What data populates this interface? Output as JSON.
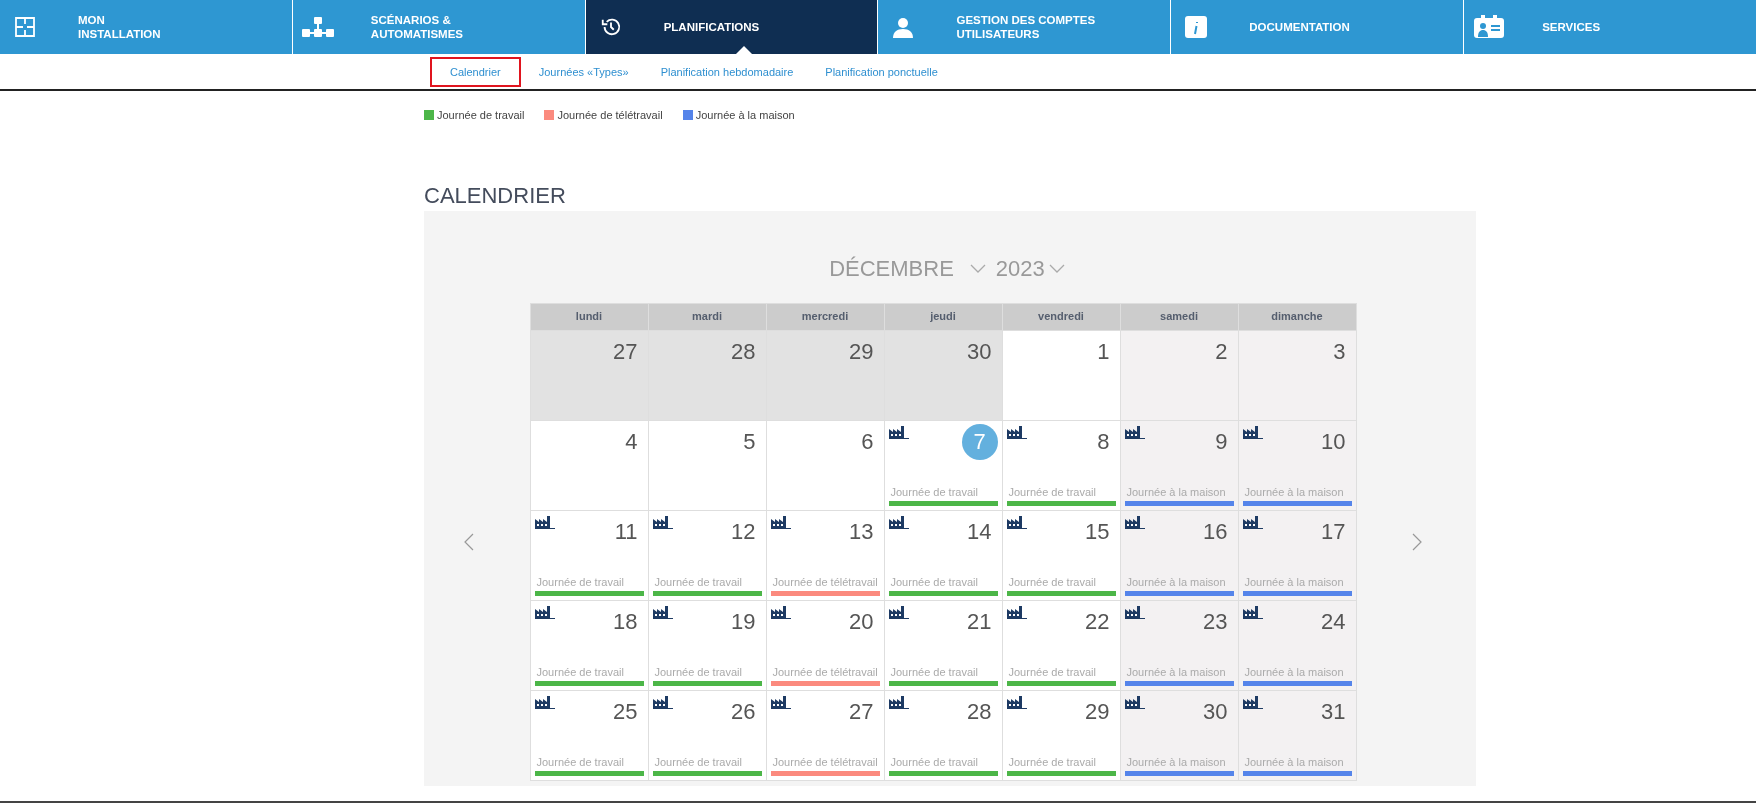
{
  "nav": [
    {
      "label": "MON\nINSTALLATION",
      "kind": "plan",
      "selected": false
    },
    {
      "label": "SCÉNARIOS &\nAUTOMATISMES",
      "kind": "flow",
      "selected": false
    },
    {
      "label": "PLANIFICATIONS",
      "kind": "history",
      "selected": true
    },
    {
      "label": "GESTION DES COMPTES\nUTILISATEURS",
      "kind": "user",
      "selected": false
    },
    {
      "label": "DOCUMENTATION",
      "kind": "info",
      "selected": false
    },
    {
      "label": "SERVICES",
      "kind": "badge",
      "selected": false
    }
  ],
  "subnav": [
    {
      "label": "Calendrier",
      "selected": true
    },
    {
      "label": "Journées «Types»",
      "selected": false
    },
    {
      "label": "Planification hebdomadaire",
      "selected": false
    },
    {
      "label": "Planification ponctuelle",
      "selected": false
    }
  ],
  "legend": [
    {
      "label": "Journée de travail",
      "color": "#4cb648"
    },
    {
      "label": "Journée de télétravail",
      "color": "#fb8a7e"
    },
    {
      "label": "Journée à la maison",
      "color": "#5584ea"
    }
  ],
  "title": "CALENDRIER",
  "calendar": {
    "month": "DÉCEMBRE",
    "year": "2023",
    "weekdays": [
      "lundi",
      "mardi",
      "mercredi",
      "jeudi",
      "vendredi",
      "samedi",
      "dimanche"
    ],
    "weeks": [
      [
        {
          "day": "27",
          "kind": "outside"
        },
        {
          "day": "28",
          "kind": "outside"
        },
        {
          "day": "29",
          "kind": "outside"
        },
        {
          "day": "30",
          "kind": "outside"
        },
        {
          "day": "1",
          "kind": "weekday"
        },
        {
          "day": "2",
          "kind": "weekend"
        },
        {
          "day": "3",
          "kind": "weekend"
        }
      ],
      [
        {
          "day": "4",
          "kind": "weekday"
        },
        {
          "day": "5",
          "kind": "weekday"
        },
        {
          "day": "6",
          "kind": "weekday"
        },
        {
          "day": "7",
          "kind": "weekday",
          "today": true,
          "scheduled": true,
          "label": "Journée de travail",
          "color": "#4cb648"
        },
        {
          "day": "8",
          "kind": "weekday",
          "scheduled": true,
          "label": "Journée de travail",
          "color": "#4cb648"
        },
        {
          "day": "9",
          "kind": "weekend",
          "scheduled": true,
          "label": "Journée à la maison",
          "color": "#5584ea"
        },
        {
          "day": "10",
          "kind": "weekend",
          "scheduled": true,
          "label": "Journée à la maison",
          "color": "#5584ea"
        }
      ],
      [
        {
          "day": "11",
          "kind": "weekday",
          "scheduled": true,
          "label": "Journée de travail",
          "color": "#4cb648"
        },
        {
          "day": "12",
          "kind": "weekday",
          "scheduled": true,
          "label": "Journée de travail",
          "color": "#4cb648"
        },
        {
          "day": "13",
          "kind": "weekday",
          "scheduled": true,
          "label": "Journée de télétravail",
          "color": "#fb8a7e"
        },
        {
          "day": "14",
          "kind": "weekday",
          "scheduled": true,
          "label": "Journée de travail",
          "color": "#4cb648"
        },
        {
          "day": "15",
          "kind": "weekday",
          "scheduled": true,
          "label": "Journée de travail",
          "color": "#4cb648"
        },
        {
          "day": "16",
          "kind": "weekend",
          "scheduled": true,
          "label": "Journée à la maison",
          "color": "#5584ea"
        },
        {
          "day": "17",
          "kind": "weekend",
          "scheduled": true,
          "label": "Journée à la maison",
          "color": "#5584ea"
        }
      ],
      [
        {
          "day": "18",
          "kind": "weekday",
          "scheduled": true,
          "label": "Journée de travail",
          "color": "#4cb648"
        },
        {
          "day": "19",
          "kind": "weekday",
          "scheduled": true,
          "label": "Journée de travail",
          "color": "#4cb648"
        },
        {
          "day": "20",
          "kind": "weekday",
          "scheduled": true,
          "label": "Journée de télétravail",
          "color": "#fb8a7e"
        },
        {
          "day": "21",
          "kind": "weekday",
          "scheduled": true,
          "label": "Journée de travail",
          "color": "#4cb648"
        },
        {
          "day": "22",
          "kind": "weekday",
          "scheduled": true,
          "label": "Journée de travail",
          "color": "#4cb648"
        },
        {
          "day": "23",
          "kind": "weekend",
          "scheduled": true,
          "label": "Journée à la maison",
          "color": "#5584ea"
        },
        {
          "day": "24",
          "kind": "weekend",
          "scheduled": true,
          "label": "Journée à la maison",
          "color": "#5584ea"
        }
      ],
      [
        {
          "day": "25",
          "kind": "weekday",
          "scheduled": true,
          "label": "Journée de travail",
          "color": "#4cb648"
        },
        {
          "day": "26",
          "kind": "weekday",
          "scheduled": true,
          "label": "Journée de travail",
          "color": "#4cb648"
        },
        {
          "day": "27",
          "kind": "weekday",
          "scheduled": true,
          "label": "Journée de télétravail",
          "color": "#fb8a7e"
        },
        {
          "day": "28",
          "kind": "weekday",
          "scheduled": true,
          "label": "Journée de travail",
          "color": "#4cb648"
        },
        {
          "day": "29",
          "kind": "weekday",
          "scheduled": true,
          "label": "Journée de travail",
          "color": "#4cb648"
        },
        {
          "day": "30",
          "kind": "weekend",
          "scheduled": true,
          "label": "Journée à la maison",
          "color": "#5584ea"
        },
        {
          "day": "31",
          "kind": "weekend",
          "scheduled": true,
          "label": "Journée à la maison",
          "color": "#5584ea"
        }
      ]
    ]
  }
}
